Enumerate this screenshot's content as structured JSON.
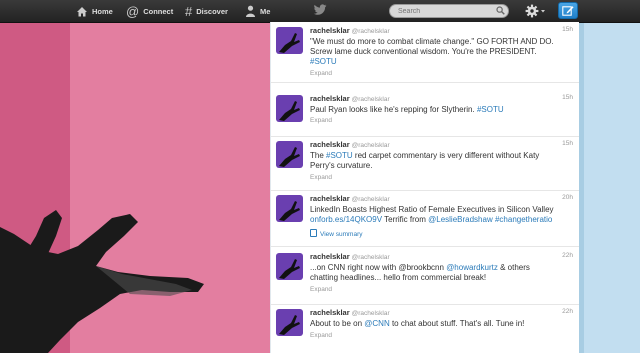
{
  "nav": {
    "home": "Home",
    "connect": "Connect",
    "discover": "Discover",
    "me": "Me"
  },
  "search": {
    "placeholder": "Search"
  },
  "colors": {
    "link": "#2b7bb9",
    "avatar": "#6a3fb0",
    "compose": "#1f7fc8",
    "background_pink": "#e37ea0"
  },
  "tweets": [
    {
      "name": "rachelsklar",
      "handle": "@rachelsklar",
      "time": "15h",
      "line1": "\"We must do more to combat climate change.\" GO FORTH AND DO.",
      "line2": "Screw lame duck conventional wisdom. You're the PRESIDENT.",
      "tag": "#SOTU",
      "expand": "Expand"
    },
    {
      "name": "rachelsklar",
      "handle": "@rachelsklar",
      "time": "15h",
      "text": "Paul Ryan looks like he's repping for Slytherin. ",
      "tag": "#SOTU",
      "expand": "Expand"
    },
    {
      "name": "rachelsklar",
      "handle": "@rachelsklar",
      "time": "15h",
      "pre": "The ",
      "tag": "#SOTU",
      "post": " red carpet commentary is very different without Katy",
      "line2": "Perry's curvature.",
      "expand": "Expand"
    },
    {
      "name": "rachelsklar",
      "handle": "@rachelsklar",
      "time": "20h",
      "line1": "LinkedIn Boasts Highest Ratio of Female Executives in Silicon Valley",
      "link1": "onforb.es/14QKO9V",
      "mid": " Terrific from ",
      "link2": "@LeslieBradshaw",
      "space": " ",
      "link3": "#changetheratio",
      "expand": "View summary"
    },
    {
      "name": "rachelsklar",
      "handle": "@rachelsklar",
      "time": "22h",
      "pre": "...on CNN right now with @brookbcnn ",
      "link1": "@howardkurtz",
      "post": " & others",
      "line2": "chatting headlines... hello from commercial break!",
      "expand": "Expand"
    },
    {
      "name": "rachelsklar",
      "handle": "@rachelsklar",
      "time": "22h",
      "pre": "About to be on ",
      "link1": "@CNN",
      "post": " to chat about stuff. That's all. Tune in!",
      "expand": "Expand"
    }
  ]
}
